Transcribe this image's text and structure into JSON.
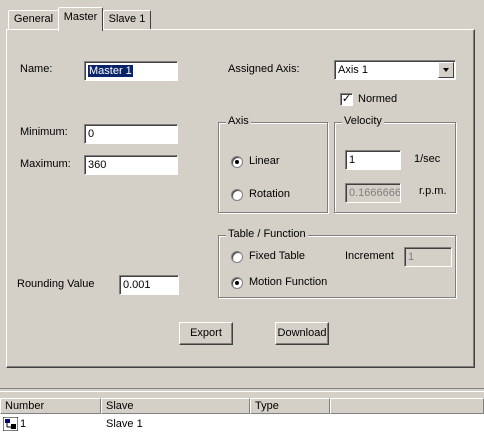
{
  "tabs": [
    "General",
    "Master",
    "Slave 1"
  ],
  "master": {
    "name_label": "Name:",
    "name_value": "Master 1",
    "assigned_axis_label": "Assigned Axis:",
    "assigned_axis_value": "Axis 1",
    "normed_label": "Normed",
    "normed_checked": true,
    "minimum_label": "Minimum:",
    "minimum_value": "0",
    "maximum_label": "Maximum:",
    "maximum_value": "360",
    "rounding_label": "Rounding Value",
    "rounding_value": "0.001",
    "axis_group": {
      "title": "Axis",
      "options": [
        "Linear",
        "Rotation"
      ],
      "selected": "Linear"
    },
    "velocity_group": {
      "title": "Velocity",
      "value1": "1",
      "unit1": "1/sec",
      "value2": "0.1666666",
      "unit2": "r.p.m."
    },
    "table_function_group": {
      "title": "Table / Function",
      "options": [
        "Fixed Table",
        "Motion Function"
      ],
      "selected": "Motion Function",
      "increment_label": "Increment",
      "increment_value": "1"
    },
    "export_label": "Export",
    "download_label": "Download"
  },
  "list": {
    "columns": [
      "Number",
      "Slave",
      "Type"
    ],
    "rows": [
      {
        "number": "1",
        "slave": "Slave 1",
        "type": ""
      }
    ]
  }
}
